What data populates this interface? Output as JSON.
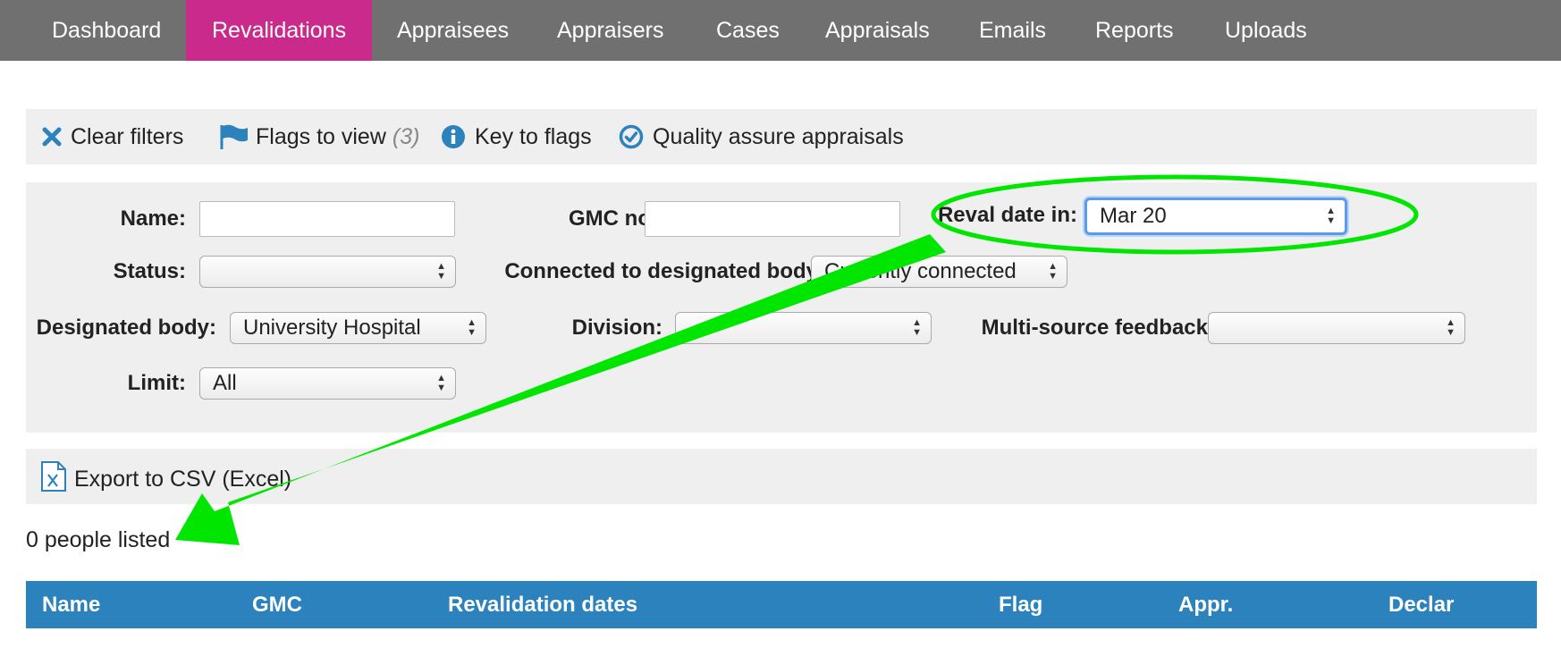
{
  "nav": {
    "items": [
      {
        "label": "Dashboard"
      },
      {
        "label": "Revalidations",
        "active": true
      },
      {
        "label": "Appraisees"
      },
      {
        "label": "Appraisers"
      },
      {
        "label": "Cases"
      },
      {
        "label": "Appraisals"
      },
      {
        "label": "Emails"
      },
      {
        "label": "Reports"
      },
      {
        "label": "Uploads"
      }
    ],
    "active_color": "#c92a8b",
    "bar_color": "#707070"
  },
  "toolbar": {
    "clear_filters": "Clear filters",
    "flags_to_view": "Flags to view",
    "flags_count": "(3)",
    "key_to_flags": "Key to flags",
    "quality_assure": "Quality assure appraisals"
  },
  "filters": {
    "name_label": "Name:",
    "name_value": "",
    "gmc_label": "GMC no:",
    "gmc_value": "",
    "reval_label": "Reval date in:",
    "reval_value": "Mar 20",
    "status_label": "Status:",
    "status_value": "",
    "connected_label": "Connected to designated body:",
    "connected_value": "Currently connected",
    "designated_label": "Designated body:",
    "designated_value": "University Hospital",
    "division_label": "Division:",
    "division_value": "",
    "msf_label": "Multi-source feedback:",
    "msf_value": "",
    "limit_label": "Limit:",
    "limit_value": "All"
  },
  "export": {
    "label": "Export to CSV (Excel)"
  },
  "results": {
    "count_text": "0 people listed"
  },
  "table": {
    "headers": [
      "Name",
      "GMC",
      "Revalidation dates",
      "Flag",
      "Appr.",
      "Declar"
    ],
    "header_color": "#2b82bd"
  },
  "icons": {
    "clear": "close-icon",
    "flags": "flag-icon",
    "key": "info-icon",
    "quality": "check-circle-icon",
    "export": "excel-file-icon"
  },
  "annotation_color": "#00e600"
}
